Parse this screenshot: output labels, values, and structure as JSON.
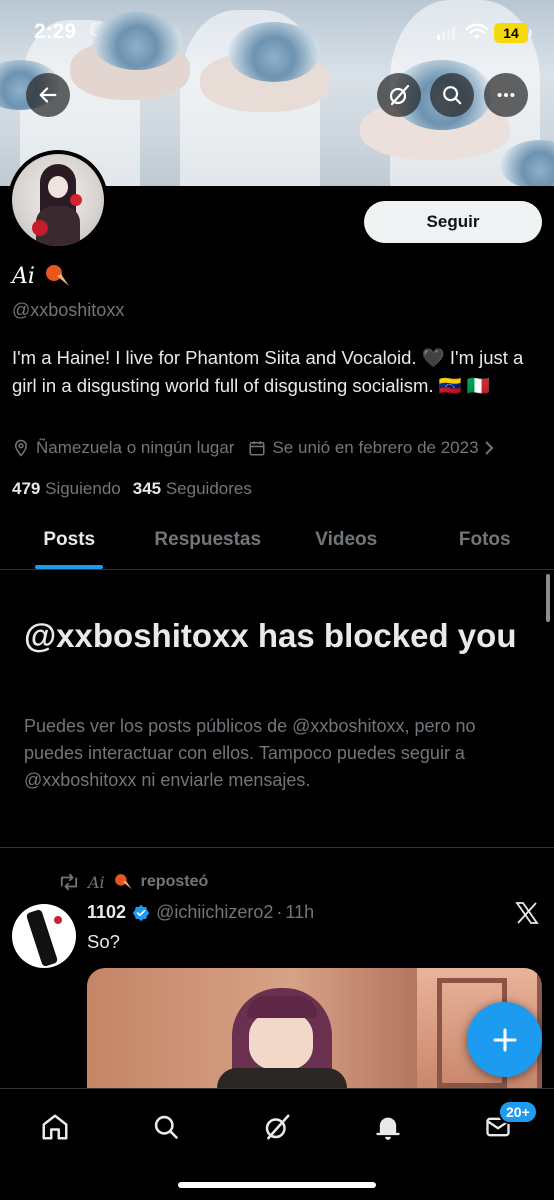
{
  "status_bar": {
    "time": "2:29",
    "battery": "14"
  },
  "header": {
    "back_icon": "arrow-left-icon",
    "actions": [
      "grok-icon",
      "search-icon",
      "more-icon"
    ]
  },
  "profile": {
    "follow_label": "Seguir",
    "display_name": "Ai",
    "handle": "@xxboshitoxx",
    "bio": "I'm a Haine! I live for Phantom Siita and Vocaloid. 🖤 I'm just a girl in a disgusting world full of disgusting socialism. 🇻🇪 🇮🇹",
    "location": "Ñamezuela o ningún lugar",
    "joined": "Se unió en febrero de 2023",
    "following_count": "479",
    "following_label": "Siguiendo",
    "followers_count": "345",
    "followers_label": "Seguidores"
  },
  "tabs": [
    {
      "label": "Posts",
      "active": true
    },
    {
      "label": "Respuestas",
      "active": false
    },
    {
      "label": "Videos",
      "active": false
    },
    {
      "label": "Fotos",
      "active": false
    }
  ],
  "blocked": {
    "title": "@xxboshitoxx has blocked you",
    "text": "Puedes ver los posts públicos de @xxboshitoxx, pero no puedes interactuar con ellos. Tampoco puedes seguir a @xxboshitoxx ni enviarle mensajes."
  },
  "post": {
    "repost_name": "Ai",
    "repost_label": "reposteó",
    "author_name": "1102",
    "author_handle": "@ichiichizero2",
    "time": "11h",
    "separator": "·",
    "text": "So?"
  },
  "bottom_nav": {
    "items": [
      "home-icon",
      "search-icon",
      "grok-icon",
      "notifications-icon",
      "messages-icon"
    ],
    "messages_badge": "20+"
  },
  "colors": {
    "accent": "#1d9bf0",
    "background": "#000000",
    "muted": "#71767b"
  }
}
